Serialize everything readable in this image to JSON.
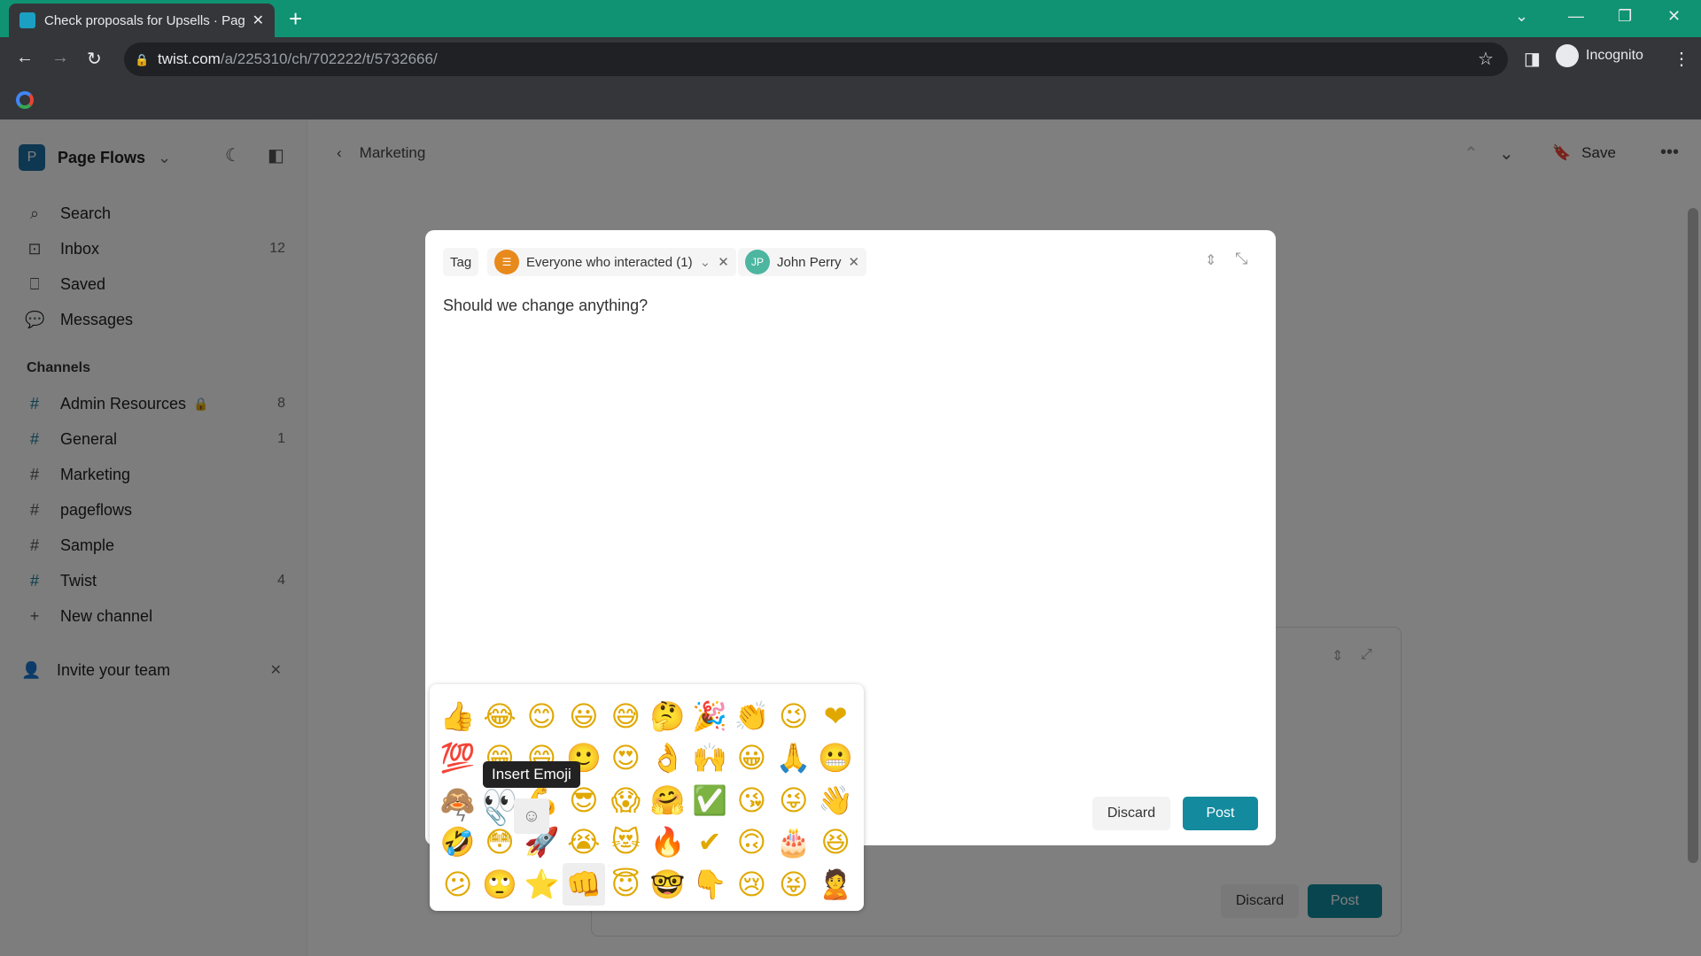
{
  "browser": {
    "tab_title": "Check proposals for Upsells · Page Flows",
    "url_domain": "twist.com",
    "url_path": "/a/225310/ch/702222/t/5732666/",
    "profile": "Incognito"
  },
  "sidebar": {
    "workspace": "Page Flows",
    "workspace_initial": "P",
    "nav": [
      {
        "label": "Search",
        "icon": "⌕"
      },
      {
        "label": "Inbox",
        "icon": "⊡",
        "count": "12"
      },
      {
        "label": "Saved",
        "icon": "⎕"
      },
      {
        "label": "Messages",
        "icon": "💬"
      }
    ],
    "channels_heading": "Channels",
    "channels": [
      {
        "label": "Admin Resources",
        "count": "8",
        "locked": true
      },
      {
        "label": "General",
        "count": "1"
      },
      {
        "label": "Marketing"
      },
      {
        "label": "pageflows"
      },
      {
        "label": "Sample"
      },
      {
        "label": "Twist",
        "count": "4"
      }
    ],
    "new_channel": "New channel",
    "invite": "Invite your team"
  },
  "header": {
    "breadcrumb": "Marketing",
    "save": "Save"
  },
  "composer": {
    "tag_label": "Tag",
    "group_chip": "Everyone who interacted (1)",
    "user_initials": "JP",
    "user_chip": "John Perry",
    "message": "Should we change anything?",
    "discard": "Discard",
    "post": "Post",
    "tooltip": "Insert Emoji"
  },
  "composer_bg": {
    "discard": "Discard",
    "post": "Post"
  },
  "emojis": [
    "👍",
    "😂",
    "😊",
    "😃",
    "😅",
    "🤔",
    "🎉",
    "👏",
    "😉",
    "❤",
    "💯",
    "😁",
    "😄",
    "🙂",
    "😍",
    "👌",
    "🙌",
    "😀",
    "🙏",
    "😬",
    "🙈",
    "👀",
    "💪",
    "😎",
    "😱",
    "🤗",
    "✅",
    "😘",
    "😜",
    "👋",
    "🤣",
    "😳",
    "🚀",
    "😭",
    "😻",
    "🔥",
    "✔",
    "🙃",
    "🎂",
    "😆",
    "😕",
    "🙄",
    "⭐",
    "👊",
    "😇",
    "🤓",
    "👇",
    "😢",
    "😝",
    "🙎"
  ],
  "colors": {
    "accent": "#138a9e",
    "chrome_green": "#0f9372"
  }
}
